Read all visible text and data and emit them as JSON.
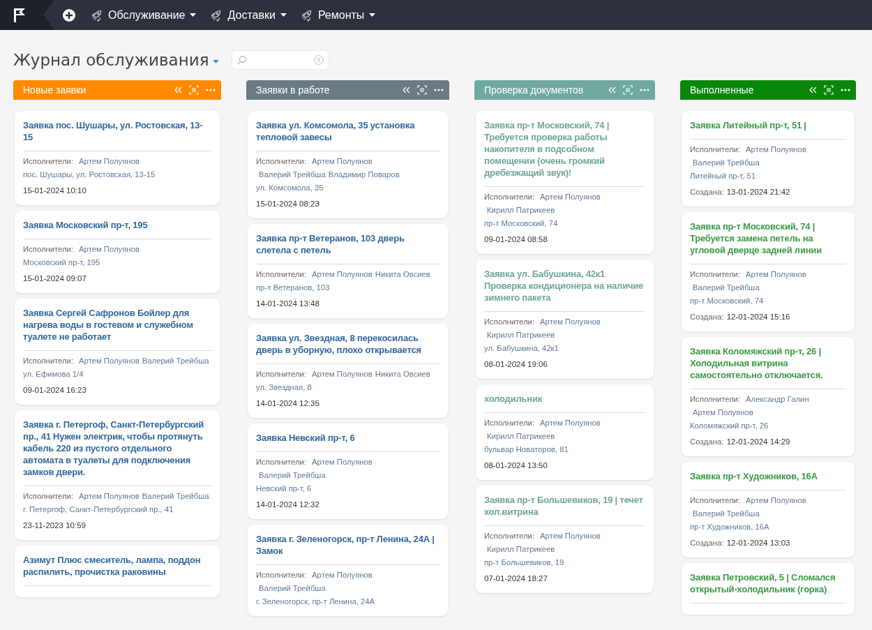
{
  "nav": {
    "menus": [
      {
        "label": "Обслуживание"
      },
      {
        "label": "Доставки"
      },
      {
        "label": "Ремонты"
      }
    ]
  },
  "page": {
    "title": "Журнал обслуживания"
  },
  "columns": [
    {
      "title": "Новые заявки",
      "kind": "new",
      "color": "#ff8a00",
      "cards": [
        {
          "title": "Заявка пос. Шушары, ул. Ростовская, 13-15",
          "performers_label": "Исполнители:",
          "performers": [
            "Артем Полуянов"
          ],
          "address": "пос. Шушары, ул. Ростовская, 13-15",
          "date": "15-01-2024 10:10"
        },
        {
          "title": "Заявка Московский пр-т, 195",
          "performers_label": "Исполнители:",
          "performers": [
            "Артем Полуянов"
          ],
          "address": "Московский пр-т, 195",
          "date": "15-01-2024 09:07"
        },
        {
          "title": "Заявка Сергей Сафронов Бойлер для нагрева воды в гостевом и служебном туалете не работает",
          "performers_label": "Исполнители:",
          "performers": [
            "Артем Полуянов",
            "Валерий Трейбша"
          ],
          "address": "ул. Ефимова 1/4",
          "date": "09-01-2024 16:23"
        },
        {
          "title": "Заявка г. Петергоф, Санкт-Петербургский пр., 41 Нужен электрик, чтобы протянуть кабель 220 из пустого отдельного автомата в туалеты для подключения замков двери.",
          "performers_label": "Исполнители:",
          "performers": [
            "Артем Полуянов",
            "Валерий Трейбша"
          ],
          "address": "г. Петергоф, Санкт-Петербургский пр., 41",
          "date": "23-11-2023 10:59"
        },
        {
          "title": "Азимут Плюс смеситель, лампа, поддон распилить, прочистка раковины"
        }
      ]
    },
    {
      "title": "Заявки в работе",
      "kind": "progress",
      "color": "#6b7a83",
      "cards": [
        {
          "title": "Заявка ул. Комсомола, 35 установка тепловой завесы",
          "performers_label": "Исполнители:",
          "performers": [
            "Артем Полуянов",
            "Валерий Трейбша",
            "Владимир Поваров"
          ],
          "address": "ул. Комсомола, 35",
          "date": "15-01-2024 08:23"
        },
        {
          "title": "Заявка пр-т Ветеранов, 103 дверь слетела с петель",
          "performers_label": "Исполнители:",
          "performers": [
            "Артем Полуянов",
            "Никита Овсиев"
          ],
          "address": "пр-т Ветеранов, 103",
          "date": "14-01-2024 13:48"
        },
        {
          "title": "Заявка ул. Звездная, 8 перекосилась дверь в уборную, плохо открывается",
          "performers_label": "Исполнители:",
          "performers": [
            "Артем Полуянов",
            "Никита Овсиев"
          ],
          "address": "ул. Звездная, 8",
          "date": "14-01-2024 12:35"
        },
        {
          "title": "Заявка Невский пр-т, 6",
          "performers_label": "Исполнители:",
          "performers": [
            "Артем Полуянов",
            "Валерий Трейбша"
          ],
          "address": "Невский пр-т, 6",
          "date": "14-01-2024 12:32"
        },
        {
          "title": "Заявка г. Зеленогорск, пр-т Ленина, 24А | Замок",
          "performers_label": "Исполнители:",
          "performers": [
            "Артем Полуянов",
            "Валерий Трейбша"
          ],
          "address": "г. Зеленогорск, пр-т Ленина, 24А"
        }
      ]
    },
    {
      "title": "Проверка документов",
      "kind": "review",
      "color": "#6fa9a0",
      "cards": [
        {
          "title": "Заявка пр-т Московский, 74 | Требуется проверка работы накопителя в подсобном помещении (очень громкий дребезжащий звук)!",
          "performers_label": "Исполнители:",
          "performers": [
            "Артем Полуянов",
            "Кирилл Патрикеев"
          ],
          "address": "пр-т Московский, 74",
          "date": "09-01-2024 08:58"
        },
        {
          "title": "Заявка ул. Бабушкина, 42к1 Проверка кондиционера на наличие зимнего пакета",
          "performers_label": "Исполнители:",
          "performers": [
            "Артем Полуянов",
            "Кирилл Патрикеев"
          ],
          "address": "ул. Бабушкина, 42к1",
          "date": "08-01-2024 19:06"
        },
        {
          "title": "холодильник",
          "performers_label": "Исполнители:",
          "performers": [
            "Артем Полуянов",
            "Кирилл Патрикеев"
          ],
          "address": "бульвар Новаторов, 81",
          "date": "08-01-2024 13:50"
        },
        {
          "title": "Заявка пр-т Большевиков, 19 | течет хол.витрина",
          "performers_label": "Исполнители:",
          "performers": [
            "Артем Полуянов",
            "Кирилл Патрикеев"
          ],
          "address": "пр-т Большевиков, 19",
          "date": "07-01-2024 18:27"
        }
      ]
    },
    {
      "title": "Выполненные",
      "kind": "done",
      "color": "#0a870a",
      "cards": [
        {
          "title": "Заявка Литейный пр-т, 51 |",
          "performers_label": "Исполнители:",
          "performers": [
            "Артем Полуянов",
            "Валерий Трейбша"
          ],
          "address": "Литейный пр-т, 51",
          "created_label": "Создана:",
          "date": "13-01-2024 21:42"
        },
        {
          "title": "Заявка пр-т Московский, 74 | Требуется замена петель на угловой дверце задней линии",
          "performers_label": "Исполнители:",
          "performers": [
            "Артем Полуянов",
            "Валерий Трейбша"
          ],
          "address": "пр-т Московский, 74",
          "created_label": "Создана:",
          "date": "12-01-2024 15:16"
        },
        {
          "title": "Заявка Коломяжский пр-т, 26 | Холодильная витрина самостоятельно отключается.",
          "performers_label": "Исполнители:",
          "performers": [
            "Александр Галин",
            "Артем Полуянов"
          ],
          "address": "Коломяжский пр-т, 26",
          "created_label": "Создана:",
          "date": "12-01-2024 14:29"
        },
        {
          "title": "Заявка пр-т Художников, 16А",
          "performers_label": "Исполнители:",
          "performers": [
            "Артем Полуянов",
            "Валерий Трейбша"
          ],
          "address": "пр-т Художников, 16А",
          "created_label": "Создана:",
          "date": "12-01-2024 13:03"
        },
        {
          "title": "Заявка Петровский, 5 | Сломался открытый-холодильник (горка)"
        }
      ]
    }
  ]
}
